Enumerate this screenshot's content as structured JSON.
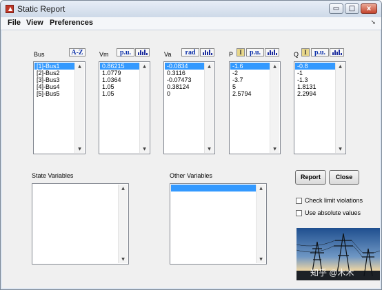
{
  "window": {
    "title": "Static Report",
    "controls": {
      "minimize": "▭",
      "maximize": "□",
      "close": "x"
    }
  },
  "menu": [
    "File",
    "View",
    "Preferences"
  ],
  "dock_glyph": "➘",
  "columns": [
    {
      "label": "Bus",
      "unit_button": "A-Z",
      "plot": false,
      "toggle": false,
      "items": [
        "[1]-Bus1",
        "[2]-Bus2",
        "[3]-Bus3",
        "[4]-Bus4",
        "[5]-Bus5"
      ],
      "selected": 0
    },
    {
      "label": "Vm",
      "unit_button": "p.u.",
      "plot": true,
      "toggle": false,
      "items": [
        "0.86215",
        "1.0779",
        "1.0364",
        "1.05",
        "1.05"
      ],
      "selected": 0
    },
    {
      "label": "Va",
      "unit_button": "rad",
      "plot": true,
      "toggle": false,
      "items": [
        "-0.0834",
        "0.3116",
        "-0.07473",
        "0.38124",
        "0"
      ],
      "selected": 0
    },
    {
      "label": "P",
      "unit_button": "p.u.",
      "plot": true,
      "toggle": true,
      "items": [
        "-1.6",
        "-2",
        "-3.7",
        "5",
        "2.5794"
      ],
      "selected": 0
    },
    {
      "label": "Q",
      "unit_button": "p.u.",
      "plot": true,
      "toggle": true,
      "items": [
        "-0.8",
        "-1",
        "-1.3",
        "1.8131",
        "2.2994"
      ],
      "selected": 0
    }
  ],
  "toggle_glyph": "I",
  "state_variables": {
    "label": "State Variables",
    "items": []
  },
  "other_variables": {
    "label": "Other Variables",
    "items": [
      ""
    ],
    "selected": 0
  },
  "buttons": {
    "report": "Report",
    "close": "Close"
  },
  "checkboxes": [
    {
      "label": "Check limit violations",
      "checked": false
    },
    {
      "label": "Use absolute values",
      "checked": false
    }
  ],
  "watermark": "知乎 @木木",
  "colors": {
    "selection": "#3399ff",
    "panel": "#f0f0f0",
    "unit_text": "#0a2fa8"
  }
}
